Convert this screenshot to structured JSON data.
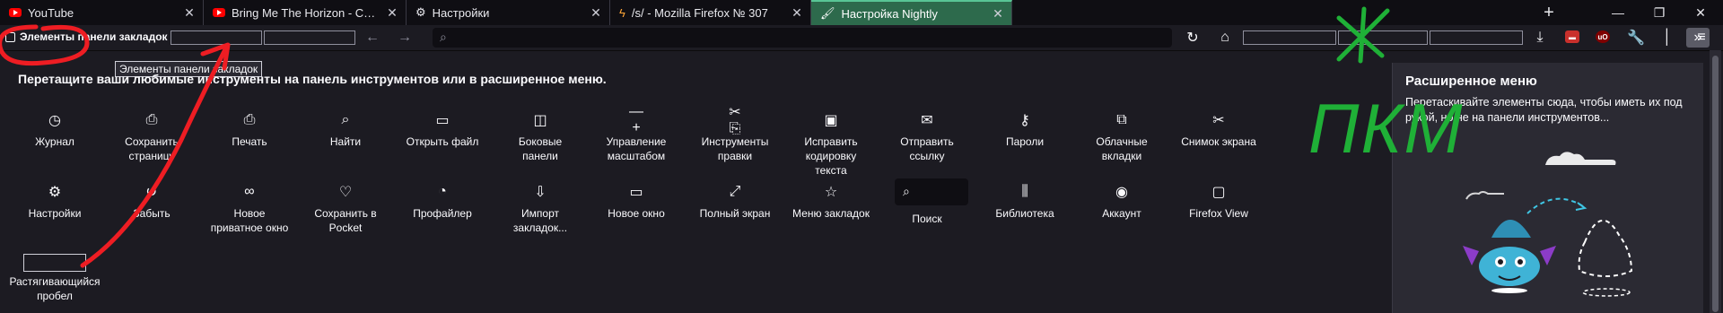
{
  "tabs": [
    {
      "label": "YouTube",
      "icon": "youtube-icon"
    },
    {
      "label": "Bring Me The Horizon - Can You Feel My Heart",
      "icon": "youtube-icon"
    },
    {
      "label": "Настройки",
      "icon": "gear-icon"
    },
    {
      "label": "/s/ - Mozilla Firefox № 307",
      "icon": "lightning-icon"
    },
    {
      "label": "Настройка Nightly",
      "icon": "paintbrush-icon",
      "active": true
    }
  ],
  "new_tab_symbol": "+",
  "window_controls": {
    "minimize": "—",
    "restore": "❐",
    "close": "✕"
  },
  "bookmarks_item_label": "Элементы панели закладок",
  "tooltip": "Элементы панели закладок",
  "heading": "Перетащите ваши любимые инструменты на панель инструментов или в расширенное меню.",
  "palette": [
    {
      "label": "Журнал",
      "icon": "clock-icon",
      "glyph": "◷"
    },
    {
      "label": "Сохранить страницу",
      "icon": "save-page-icon",
      "glyph": "⎙"
    },
    {
      "label": "Печать",
      "icon": "printer-icon",
      "glyph": "⎙"
    },
    {
      "label": "Найти",
      "icon": "search-icon",
      "glyph": "⌕"
    },
    {
      "label": "Открыть файл",
      "icon": "open-file-icon",
      "glyph": "▭"
    },
    {
      "label": "Боковые панели",
      "icon": "sidebar-icon",
      "glyph": "◫"
    },
    {
      "label": "Управление масштабом",
      "icon": "zoom-controls-icon",
      "glyph": "— +"
    },
    {
      "label": "Инструменты правки",
      "icon": "edit-controls-icon",
      "glyph": "✂ ⎘"
    },
    {
      "label": "Исправить кодировку текста",
      "icon": "text-encoding-icon",
      "glyph": "▣"
    },
    {
      "label": "Отправить ссылку",
      "icon": "email-icon",
      "glyph": "✉"
    },
    {
      "label": "Пароли",
      "icon": "key-icon",
      "glyph": "⚷"
    },
    {
      "label": "Облачные вкладки",
      "icon": "synced-tabs-icon",
      "glyph": "⧉"
    },
    {
      "label": "Снимок экрана",
      "icon": "screenshot-icon",
      "glyph": "✂"
    },
    {
      "label": "Настройки",
      "icon": "gear-icon",
      "glyph": "⚙"
    },
    {
      "label": "Забыть",
      "icon": "forget-icon",
      "glyph": "↺"
    },
    {
      "label": "Новое приватное окно",
      "icon": "private-mask-icon",
      "glyph": "∞"
    },
    {
      "label": "Сохранить в Pocket",
      "icon": "pocket-icon",
      "glyph": "♡"
    },
    {
      "label": "Профайлер",
      "icon": "profiler-icon",
      "glyph": "◔"
    },
    {
      "label": "Импорт закладок...",
      "icon": "import-icon",
      "glyph": "⇩"
    },
    {
      "label": "Новое окно",
      "icon": "new-window-icon",
      "glyph": "▭"
    },
    {
      "label": "Полный экран",
      "icon": "fullscreen-icon",
      "glyph": "⤢"
    },
    {
      "label": "Меню закладок",
      "icon": "bookmarks-menu-icon",
      "glyph": "☆"
    },
    {
      "label": "Поиск",
      "icon": "search-icon",
      "glyph": "⌕"
    },
    {
      "label": "Библиотека",
      "icon": "library-icon",
      "glyph": "⫼"
    },
    {
      "label": "Аккаунт",
      "icon": "account-icon",
      "glyph": "◉"
    },
    {
      "label": "Firefox View",
      "icon": "firefox-view-icon",
      "glyph": "▢"
    },
    {
      "label": "Растягивающийся пробел",
      "icon": "flexible-space-icon",
      "glyph": ""
    }
  ],
  "panel": {
    "title": "Расширенное меню",
    "description": "Перетаскивайте элементы сюда, чтобы иметь их под рукой, но не на панели инструментов..."
  },
  "annotation_text": "ПКМ",
  "colors": {
    "accent_tab": "#2d6a4c",
    "background": "#1c1b22",
    "annotation_red": "#ee1d23",
    "annotation_green": "#1fb037"
  }
}
